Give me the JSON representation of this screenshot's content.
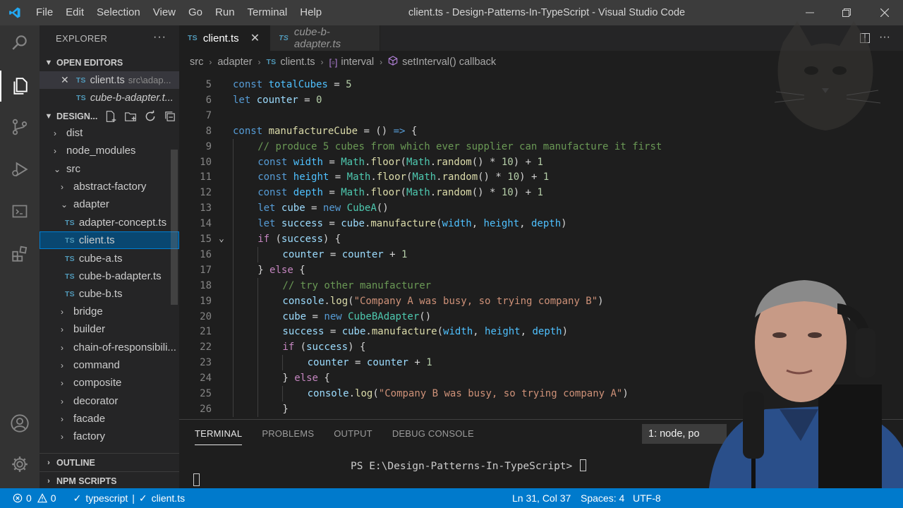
{
  "window": {
    "title": "client.ts - Design-Patterns-In-TypeScript - Visual Studio Code",
    "menu": [
      "File",
      "Edit",
      "Selection",
      "View",
      "Go",
      "Run",
      "Terminal",
      "Help"
    ]
  },
  "sidebar": {
    "title": "EXPLORER",
    "open_editors": {
      "header": "OPEN EDITORS",
      "items": [
        {
          "name": "client.ts",
          "path": "src\\adap..."
        },
        {
          "name": "cube-b-adapter.t..."
        }
      ]
    },
    "workspace": {
      "header": "DESIGN...",
      "items": [
        {
          "label": "dist",
          "type": "folder",
          "expanded": false
        },
        {
          "label": "node_modules",
          "type": "folder",
          "expanded": false
        },
        {
          "label": "src",
          "type": "folder",
          "expanded": true
        },
        {
          "label": "abstract-factory",
          "type": "folder",
          "expanded": false
        },
        {
          "label": "adapter",
          "type": "folder",
          "expanded": true
        },
        {
          "label": "adapter-concept.ts",
          "type": "ts"
        },
        {
          "label": "client.ts",
          "type": "ts",
          "selected": true
        },
        {
          "label": "cube-a.ts",
          "type": "ts"
        },
        {
          "label": "cube-b-adapter.ts",
          "type": "ts"
        },
        {
          "label": "cube-b.ts",
          "type": "ts"
        },
        {
          "label": "bridge",
          "type": "folder",
          "expanded": false
        },
        {
          "label": "builder",
          "type": "folder",
          "expanded": false
        },
        {
          "label": "chain-of-responsibili...",
          "type": "folder",
          "expanded": false
        },
        {
          "label": "command",
          "type": "folder",
          "expanded": false
        },
        {
          "label": "composite",
          "type": "folder",
          "expanded": false
        },
        {
          "label": "decorator",
          "type": "folder",
          "expanded": false
        },
        {
          "label": "facade",
          "type": "folder",
          "expanded": false
        },
        {
          "label": "factory",
          "type": "folder",
          "expanded": false
        }
      ]
    },
    "outline": "OUTLINE",
    "npm_scripts": "NPM SCRIPTS"
  },
  "tabs": [
    {
      "label": "client.ts",
      "active": true
    },
    {
      "label": "cube-b-adapter.ts",
      "active": false
    }
  ],
  "breadcrumb": {
    "items": [
      "src",
      "adapter",
      "client.ts",
      "interval",
      "setInterval() callback"
    ],
    "badge": "TS"
  },
  "editor": {
    "lines": [
      {
        "n": "5",
        "ind": 0,
        "t": [
          [
            "kw",
            "const "
          ],
          [
            "const",
            "totalCubes"
          ],
          [
            "pun",
            " = "
          ],
          [
            "num",
            "5"
          ]
        ]
      },
      {
        "n": "6",
        "ind": 0,
        "t": [
          [
            "kw",
            "let "
          ],
          [
            "var",
            "counter"
          ],
          [
            "pun",
            " = "
          ],
          [
            "num",
            "0"
          ]
        ]
      },
      {
        "n": "7",
        "ind": 0,
        "t": []
      },
      {
        "n": "8",
        "ind": 0,
        "t": [
          [
            "kw",
            "const "
          ],
          [
            "fn",
            "manufactureCube"
          ],
          [
            "pun",
            " = () "
          ],
          [
            "kw",
            "=>"
          ],
          [
            "pun",
            " {"
          ]
        ]
      },
      {
        "n": "9",
        "ind": 1,
        "t": [
          [
            "cmt",
            "// produce 5 cubes from which ever supplier can manufacture it first"
          ]
        ]
      },
      {
        "n": "10",
        "ind": 1,
        "t": [
          [
            "kw",
            "const "
          ],
          [
            "const",
            "width"
          ],
          [
            "pun",
            " = "
          ],
          [
            "cls",
            "Math"
          ],
          [
            "pun",
            "."
          ],
          [
            "fn",
            "floor"
          ],
          [
            "pun",
            "("
          ],
          [
            "cls",
            "Math"
          ],
          [
            "pun",
            "."
          ],
          [
            "fn",
            "random"
          ],
          [
            "pun",
            "() * "
          ],
          [
            "num",
            "10"
          ],
          [
            "pun",
            ") + "
          ],
          [
            "num",
            "1"
          ]
        ]
      },
      {
        "n": "11",
        "ind": 1,
        "t": [
          [
            "kw",
            "const "
          ],
          [
            "const",
            "height"
          ],
          [
            "pun",
            " = "
          ],
          [
            "cls",
            "Math"
          ],
          [
            "pun",
            "."
          ],
          [
            "fn",
            "floor"
          ],
          [
            "pun",
            "("
          ],
          [
            "cls",
            "Math"
          ],
          [
            "pun",
            "."
          ],
          [
            "fn",
            "random"
          ],
          [
            "pun",
            "() * "
          ],
          [
            "num",
            "10"
          ],
          [
            "pun",
            ") + "
          ],
          [
            "num",
            "1"
          ]
        ]
      },
      {
        "n": "12",
        "ind": 1,
        "t": [
          [
            "kw",
            "const "
          ],
          [
            "const",
            "depth"
          ],
          [
            "pun",
            " = "
          ],
          [
            "cls",
            "Math"
          ],
          [
            "pun",
            "."
          ],
          [
            "fn",
            "floor"
          ],
          [
            "pun",
            "("
          ],
          [
            "cls",
            "Math"
          ],
          [
            "pun",
            "."
          ],
          [
            "fn",
            "random"
          ],
          [
            "pun",
            "() * "
          ],
          [
            "num",
            "10"
          ],
          [
            "pun",
            ") + "
          ],
          [
            "num",
            "1"
          ]
        ]
      },
      {
        "n": "13",
        "ind": 1,
        "t": [
          [
            "kw",
            "let "
          ],
          [
            "var",
            "cube"
          ],
          [
            "pun",
            " = "
          ],
          [
            "kw",
            "new "
          ],
          [
            "cls",
            "CubeA"
          ],
          [
            "pun",
            "()"
          ]
        ]
      },
      {
        "n": "14",
        "ind": 1,
        "t": [
          [
            "kw",
            "let "
          ],
          [
            "var",
            "success"
          ],
          [
            "pun",
            " = "
          ],
          [
            "var",
            "cube"
          ],
          [
            "pun",
            "."
          ],
          [
            "fn",
            "manufacture"
          ],
          [
            "pun",
            "("
          ],
          [
            "const",
            "width"
          ],
          [
            "pun",
            ", "
          ],
          [
            "const",
            "height"
          ],
          [
            "pun",
            ", "
          ],
          [
            "const",
            "depth"
          ],
          [
            "pun",
            ")"
          ]
        ]
      },
      {
        "n": "15",
        "ind": 1,
        "t": [
          [
            "ctl",
            "if"
          ],
          [
            "pun",
            " ("
          ],
          [
            "var",
            "success"
          ],
          [
            "pun",
            ") {"
          ]
        ]
      },
      {
        "n": "16",
        "ind": 2,
        "t": [
          [
            "var",
            "counter"
          ],
          [
            "pun",
            " = "
          ],
          [
            "var",
            "counter"
          ],
          [
            "pun",
            " + "
          ],
          [
            "num",
            "1"
          ]
        ]
      },
      {
        "n": "17",
        "ind": 1,
        "t": [
          [
            "pun",
            "} "
          ],
          [
            "ctl",
            "else"
          ],
          [
            "pun",
            " {"
          ]
        ]
      },
      {
        "n": "18",
        "ind": 2,
        "t": [
          [
            "cmt",
            "// try other manufacturer"
          ]
        ]
      },
      {
        "n": "19",
        "ind": 2,
        "t": [
          [
            "var",
            "console"
          ],
          [
            "pun",
            "."
          ],
          [
            "fn",
            "log"
          ],
          [
            "pun",
            "("
          ],
          [
            "str",
            "\"Company A was busy, so trying company B\""
          ],
          [
            "pun",
            ")"
          ]
        ]
      },
      {
        "n": "20",
        "ind": 2,
        "t": [
          [
            "var",
            "cube"
          ],
          [
            "pun",
            " = "
          ],
          [
            "kw",
            "new "
          ],
          [
            "cls",
            "CubeBAdapter"
          ],
          [
            "pun",
            "()"
          ]
        ]
      },
      {
        "n": "21",
        "ind": 2,
        "t": [
          [
            "var",
            "success"
          ],
          [
            "pun",
            " = "
          ],
          [
            "var",
            "cube"
          ],
          [
            "pun",
            "."
          ],
          [
            "fn",
            "manufacture"
          ],
          [
            "pun",
            "("
          ],
          [
            "const",
            "width"
          ],
          [
            "pun",
            ", "
          ],
          [
            "const",
            "height"
          ],
          [
            "pun",
            ", "
          ],
          [
            "const",
            "depth"
          ],
          [
            "pun",
            ")"
          ]
        ]
      },
      {
        "n": "22",
        "ind": 2,
        "t": [
          [
            "ctl",
            "if"
          ],
          [
            "pun",
            " ("
          ],
          [
            "var",
            "success"
          ],
          [
            "pun",
            ") {"
          ]
        ]
      },
      {
        "n": "23",
        "ind": 3,
        "t": [
          [
            "var",
            "counter"
          ],
          [
            "pun",
            " = "
          ],
          [
            "var",
            "counter"
          ],
          [
            "pun",
            " + "
          ],
          [
            "num",
            "1"
          ]
        ]
      },
      {
        "n": "24",
        "ind": 2,
        "t": [
          [
            "pun",
            "} "
          ],
          [
            "ctl",
            "else"
          ],
          [
            "pun",
            " {"
          ]
        ]
      },
      {
        "n": "25",
        "ind": 3,
        "t": [
          [
            "var",
            "console"
          ],
          [
            "pun",
            "."
          ],
          [
            "fn",
            "log"
          ],
          [
            "pun",
            "("
          ],
          [
            "str",
            "\"Company B was busy, so trying company A\""
          ],
          [
            "pun",
            ")"
          ]
        ]
      },
      {
        "n": "26",
        "ind": 2,
        "t": [
          [
            "pun",
            "}"
          ]
        ]
      }
    ]
  },
  "panel": {
    "tabs": [
      "TERMINAL",
      "PROBLEMS",
      "OUTPUT",
      "DEBUG CONSOLE"
    ],
    "terminal_select": "1: node, po",
    "prompt": "PS E:\\Design-Patterns-In-TypeScript> "
  },
  "statusbar": {
    "errors": "0",
    "warnings": "0",
    "typescript": "typescript",
    "separator": "|",
    "file": "client.ts",
    "position": "Ln 31, Col 37",
    "spaces": "Spaces: 4",
    "encoding": "UTF-8"
  },
  "colors": {
    "statusbar": "#007acc",
    "selection": "#094771",
    "titlebar": "#3c3c3c",
    "editor_bg": "#1e1e1e",
    "sidebar_bg": "#252526"
  }
}
